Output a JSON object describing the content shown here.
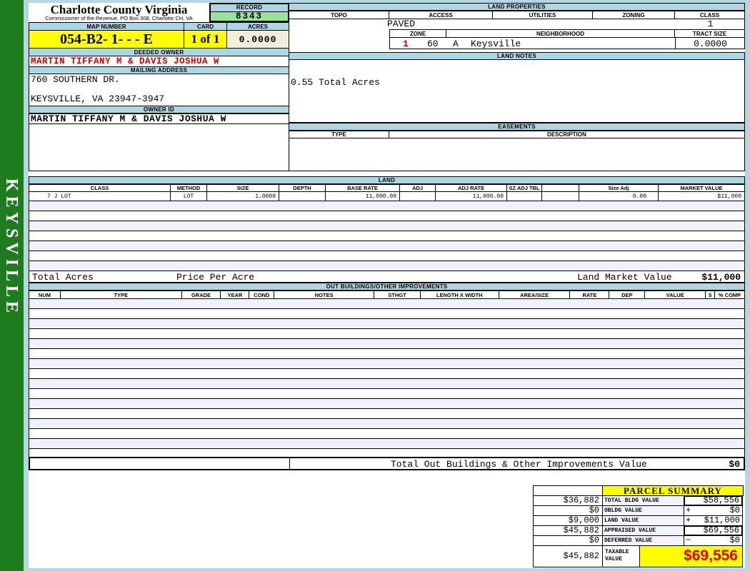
{
  "sidebar": {
    "district": "KEYSVILLE"
  },
  "header": {
    "county": "Charlotte County Virginia",
    "office": "Commissioner of the Revenue, PO Box 308, Charlotte CH, VA",
    "record_label": "RECORD",
    "record_value": "8343",
    "map_number_label": "MAP NUMBER",
    "map_number": "054-B2- 1-  -  -  E",
    "card_label": "CARD",
    "card": "1 of 1",
    "acres_label": "ACRES",
    "acres": "0.0000"
  },
  "owner": {
    "deeded_owner_label": "DEEDED OWNER",
    "deeded_owner": "MARTIN TIFFANY M & DAVIS JOSHUA W",
    "mailing_address_label": "MAILING ADDRESS",
    "address_line1": "760 SOUTHERN DR.",
    "address_line2": "KEYSVILLE, VA 23947-3947",
    "owner_id_label": "OWNER ID",
    "owner_id": "MARTIN TIFFANY M & DAVIS JOSHUA W"
  },
  "land_properties": {
    "title": "LAND PROPERTIES",
    "headers": [
      "TOPO",
      "ACCESS",
      "UTILITIES",
      "ZONING",
      "CLASS"
    ],
    "access_value": "PAVED",
    "class_value": "1",
    "zone_label": "ZONE",
    "neighborhood_label": "NEIGHBORHOOD",
    "tract_size_label": "TRACT SIZE",
    "zone_value": "1",
    "zone_code": "60",
    "zone_letter": "A",
    "neighborhood": "Keysville",
    "tract_size": "0.0000"
  },
  "land_notes": {
    "title": "LAND NOTES",
    "note": "0.55 Total Acres"
  },
  "easements": {
    "title": "EASEMENTS",
    "type_label": "TYPE",
    "description_label": "DESCRIPTION"
  },
  "land": {
    "title": "LAND",
    "headers": [
      "CLASS",
      "METHOD",
      "SIZE",
      "DEPTH",
      "BASE RATE",
      "ADJ",
      "ADJ RATE",
      "SZ ADJ TBL",
      "",
      "Size Adj",
      "MARKET VALUE"
    ],
    "row": {
      "class": "7 J LOT",
      "method": "LOT",
      "size": "1.0000",
      "depth": "",
      "base_rate": "11,000.00",
      "adj": "",
      "adj_rate": "11,000.00",
      "sz_adj_tbl": "",
      "size_adj": "0.00",
      "market_value": "$11,000"
    },
    "total_acres_label": "Total Acres",
    "price_per_acre_label": "Price Per Acre",
    "market_value_label": "Land Market Value",
    "market_value_total": "$11,000"
  },
  "out_buildings": {
    "title": "OUT BUILDINGS/OTHER IMPROVEMENTS",
    "headers": [
      "NUM",
      "TYPE",
      "GRADE",
      "YEAR",
      "COND",
      "NOTES",
      "STHGT",
      "LENGTH X WIDTH",
      "AREA/SIZE",
      "RATE",
      "DEP",
      "VALUE",
      "S",
      "% COMP"
    ],
    "total_label": "Total Out Buildings & Other Improvements Value",
    "total_value": "$0"
  },
  "parcel_summary": {
    "title": "PARCEL SUMMARY",
    "rows": [
      {
        "prior": "$36,882",
        "label": "TOTAL BLDG VALUE",
        "sign": "",
        "value": "$58,556"
      },
      {
        "prior": "$0",
        "label": "OBLDG VALUE",
        "sign": "+",
        "value": "$0"
      },
      {
        "prior": "$9,000",
        "label": "LAND VALUE",
        "sign": "+",
        "value": "$11,000"
      },
      {
        "prior": "$45,882",
        "label": "APPRAISED VALUE",
        "sign": "",
        "value": "$69,556"
      },
      {
        "prior": "$0",
        "label": "DEFERRED VALUE",
        "sign": "−",
        "value": "$0"
      }
    ],
    "taxable": {
      "prior": "$45,882",
      "label": "TAXABLE VALUE",
      "value": "$69,556"
    }
  },
  "colors": {
    "page_background": "#b2d7e5",
    "header_bar": "#aed7e6",
    "sidebar_green": "#1e7c1e",
    "record_green": "#9ae49a",
    "highlight_yellow": "#ffff00",
    "acres_cream": "#f0f0da",
    "stripe_lavender": "#f1f1f9",
    "alert_red": "#cc0000",
    "taxable_red": "#e00000"
  }
}
